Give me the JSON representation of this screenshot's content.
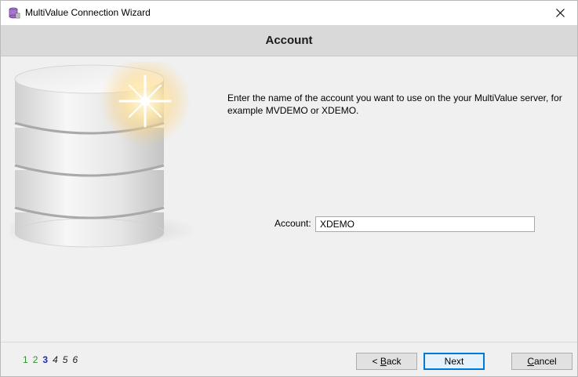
{
  "window": {
    "title": "MultiValue Connection Wizard",
    "app_icon": "database-wizard-icon",
    "close_icon": "close-icon"
  },
  "header": {
    "title": "Account"
  },
  "main": {
    "instructions": "Enter the name of the account you want to use on the your MultiValue server, for example MVDEMO or XDEMO.",
    "account_label": "Account:",
    "account_value": "XDEMO",
    "illustration": "database-icon"
  },
  "footer": {
    "steps": [
      "1",
      "2",
      "3",
      "4",
      "5",
      "6"
    ],
    "current_step": "3",
    "back_prefix": "< ",
    "back_mnemonic": "B",
    "back_rest": "ack",
    "next_label": "Next",
    "cancel_mnemonic": "C",
    "cancel_rest": "ancel"
  },
  "colors": {
    "header_bg": "#d9d9d9",
    "step_done": "#3a8a3a",
    "step_current": "#1f2bb8",
    "default_button_border": "#0078d7"
  }
}
